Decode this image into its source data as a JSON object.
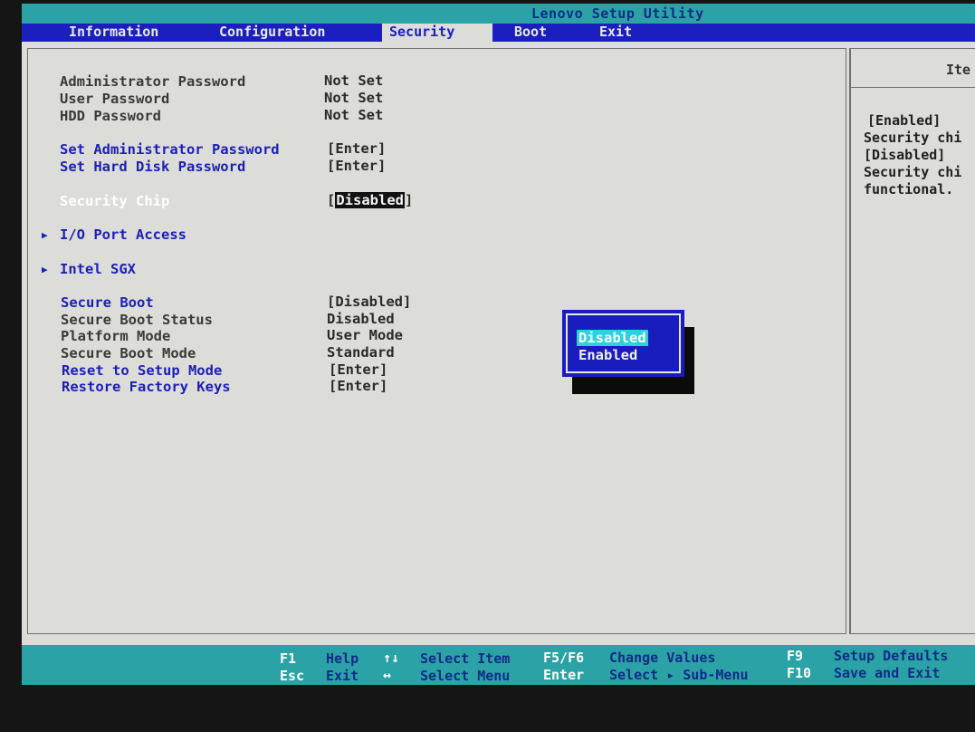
{
  "app_title": "Lenovo Setup Utility",
  "menu": {
    "tabs": [
      {
        "label": "Information"
      },
      {
        "label": "Configuration"
      },
      {
        "label": "Security"
      },
      {
        "label": "Boot"
      },
      {
        "label": "Exit"
      }
    ],
    "active": "Security"
  },
  "security": {
    "admin_password": {
      "label": "Administrator Password",
      "value": "Not Set"
    },
    "user_password": {
      "label": "User Password",
      "value": "Not Set"
    },
    "hdd_password": {
      "label": "HDD Password",
      "value": "Not Set"
    },
    "set_admin_password": {
      "label": "Set Administrator Password",
      "value": "[Enter]"
    },
    "set_hdd_password": {
      "label": "Set Hard Disk Password",
      "value": "[Enter]"
    },
    "security_chip": {
      "label": "Security Chip",
      "value_open": "[",
      "value": "Disabled",
      "value_close": "]"
    },
    "io_port_access": {
      "label": "I/O Port Access"
    },
    "intel_sgx": {
      "label": "Intel SGX"
    },
    "secure_boot": {
      "label": "Secure Boot",
      "value": "[Disabled]"
    },
    "secure_boot_status": {
      "label": "Secure Boot Status",
      "value": "Disabled"
    },
    "platform_mode": {
      "label": "Platform Mode",
      "value": "User Mode"
    },
    "secure_boot_mode": {
      "label": "Secure Boot Mode",
      "value": "Standard"
    },
    "reset_setup_mode": {
      "label": "Reset to Setup Mode",
      "value": "[Enter]"
    },
    "restore_factory_keys": {
      "label": "Restore Factory Keys",
      "value": "[Enter]"
    }
  },
  "help": {
    "header": "Ite",
    "lines": [
      "[Enabled]",
      "Security chi",
      "[Disabled]",
      "Security chi",
      "functional."
    ]
  },
  "popup": {
    "options": [
      "Disabled",
      "Enabled"
    ],
    "selected": "Disabled"
  },
  "footer": {
    "f1_key": "F1",
    "f1_desc": "Help",
    "esc_key": "Esc",
    "esc_desc": "Exit",
    "updown_key": "↑↓",
    "updown_desc": "Select Item",
    "leftright_key": "↔",
    "leftright_desc": "Select Menu",
    "f5f6_key": "F5/F6",
    "f5f6_desc": "Change Values",
    "enter_key": "Enter",
    "enter_desc": "Select ▸ Sub-Menu",
    "f9_key": "F9",
    "f9_desc": "Setup Defaults",
    "f10_key": "F10",
    "f10_desc": "Save and Exit"
  },
  "colors": {
    "title_bar": "#2ba3a6",
    "menu_bar": "#1b1fbf",
    "panel_bg": "#dcdcd8",
    "link_blue": "#1c1fb8",
    "popup_bg": "#1a1dbd",
    "popup_highlight": "#2bd3d9"
  }
}
